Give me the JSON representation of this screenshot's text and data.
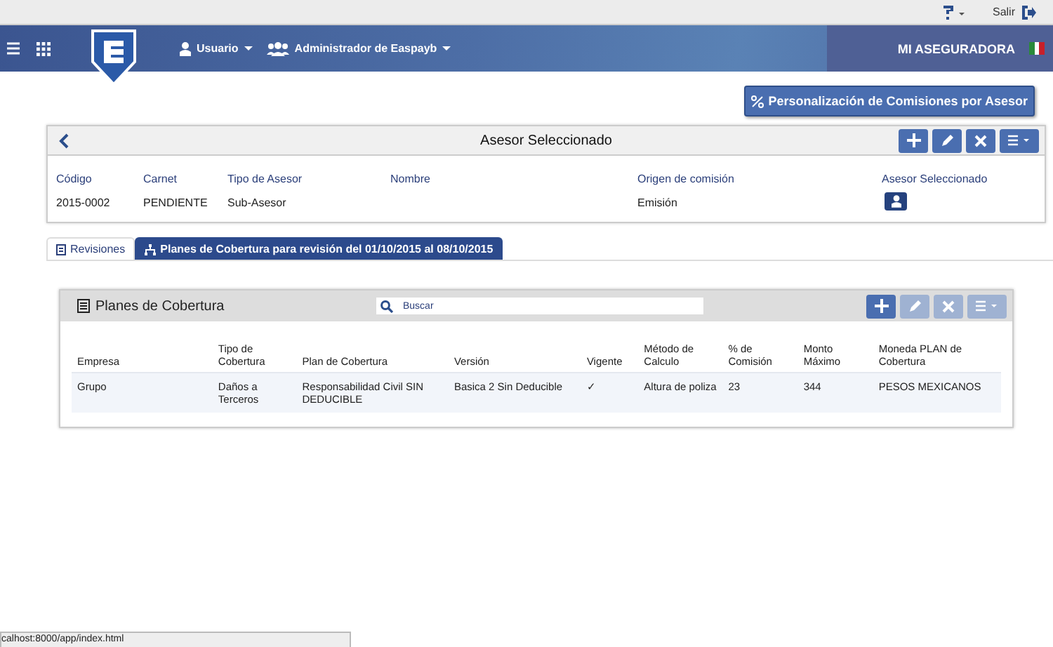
{
  "top_bar": {
    "exit": "Salir"
  },
  "header": {
    "menus": [
      "Usuario",
      "Administrador de Easpayb"
    ],
    "company": "MI ASEGURADORA"
  },
  "custom_button": "Personalización de Comisiones por Asesor",
  "asesor_card": {
    "title": "Asesor Seleccionado",
    "actions": [
      {
        "kind": "add",
        "disabled": false
      },
      {
        "kind": "edit",
        "disabled": false
      },
      {
        "kind": "delete",
        "disabled": false
      },
      {
        "kind": "menu",
        "disabled": false
      }
    ],
    "fields": [
      {
        "label": "Código",
        "value": "2015-0002"
      },
      {
        "label": "Carnet",
        "value": "PENDIENTE"
      },
      {
        "label": "Tipo de Asesor",
        "value": "Sub-Asesor"
      },
      {
        "label": "Nombre"
      },
      {
        "label": "Origen de comisión",
        "value": "Emisión"
      },
      {
        "label": "Asesor Seleccionado",
        "kind": "button"
      }
    ]
  },
  "tabs": [
    {
      "label": "Revisiones",
      "selected": false
    },
    {
      "label": "Planes de Cobertura para revisión del 01/10/2015 al 08/10/2015",
      "selected": true
    }
  ],
  "planes": {
    "title": "Planes de Cobertura",
    "search": {
      "placeholder": "Buscar"
    },
    "actions": [
      {
        "kind": "add",
        "disabled": false
      },
      {
        "kind": "edit",
        "disabled": true
      },
      {
        "kind": "delete",
        "disabled": true
      },
      {
        "kind": "menu",
        "disabled": true
      }
    ],
    "table": {
      "columns": [
        "Empresa",
        "Tipo de Cobertura",
        "Plan de Cobertura",
        "Versión",
        "Vigente",
        "Método de Calculo",
        "% de Comisión",
        "Monto Máximo",
        "Moneda PLAN de Cobertura"
      ],
      "rows": [
        [
          "Grupo",
          "Daños a Terceros",
          "Responsabilidad Civil SIN DEDUCIBLE",
          "Basica 2 Sin Deducible",
          "✓",
          "Altura de poliza",
          "23",
          "344",
          "PESOS MEXICANOS"
        ]
      ]
    }
  },
  "status_bar": "calhost:8000/app/index.html"
}
